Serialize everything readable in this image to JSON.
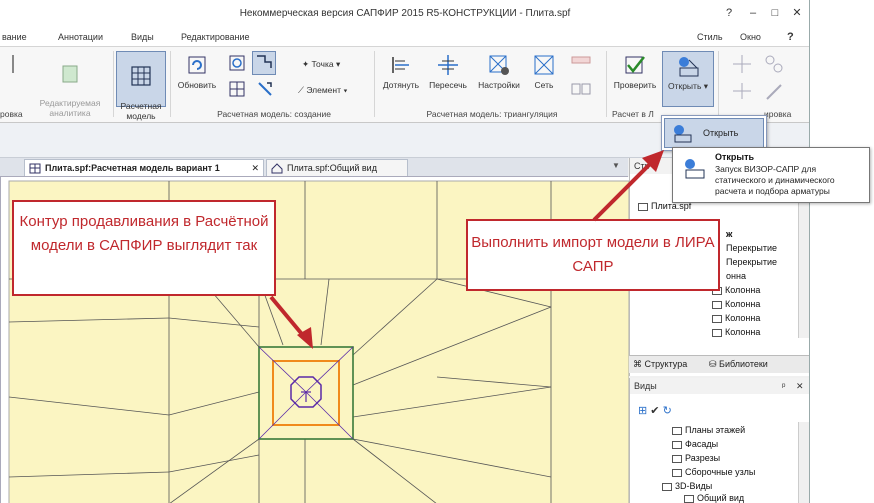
{
  "window": {
    "title": "Некоммерческая версия САПФИР 2015 R5-КОНСТРУКЦИИ - Плита.spf",
    "controls": [
      "?",
      "–",
      "□",
      "✕"
    ]
  },
  "menu": {
    "items": [
      "вание",
      "Аннотации",
      "Виды",
      "Редактирование"
    ],
    "style_label": "Стиль",
    "window_label": "Окно",
    "help": "?"
  },
  "ribbon": {
    "left_cut_label": "ровка",
    "analytics_label": "Редактируемая\nаналитика",
    "calc_model_label": "Расчетная\nмодель",
    "update_label": "Обновить",
    "point_label": "Точка",
    "element_label": "Элемент",
    "extend_label": "Дотянуть",
    "intersect_label": "Пересечь",
    "settings_label": "Настройки",
    "grid_label": "Сеть",
    "check_label": "Проверить",
    "open_label": "Открыть",
    "group_create": "Расчетная модель: создание",
    "group_triangulation": "Расчетная модель: триангуляция",
    "group_calc_cut": "Расчет в Л",
    "group_right_cut": "ировка"
  },
  "tabs": [
    {
      "label": "Плита.spf:Расчетная модель вариант 1",
      "close": "✕",
      "active": true
    },
    {
      "label": "Плита.spf:Общий вид",
      "close": "",
      "active": false
    }
  ],
  "dropdown": {
    "item_label": "Открыть"
  },
  "tooltip": {
    "title": "Открыть",
    "body": "Запуск ВИЗОР-САПР для статического и динамического расчета и подбора арматуры"
  },
  "structure_panel": {
    "header": "Стр",
    "items": [
      "Плита.spf",
      "...",
      "ж",
      "Перекрытие",
      "Перекрытие",
      "онна",
      "Колонна",
      "Колонна",
      "Колонна",
      "Колонна"
    ],
    "tab_structure": "Структура",
    "tab_libraries": "Библиотеки"
  },
  "views_panel": {
    "header": "Виды",
    "pin": "ᵖ",
    "close": "✕",
    "items": [
      "Планы этажей",
      "Фасады",
      "Разрезы",
      "Сборочные узлы",
      "3D-Виды",
      "Общий вид"
    ]
  },
  "annotations": {
    "left_callout": "Контур продавливания в Расчётной модели в САПФИР выглядит так",
    "right_callout": "Выполнить импорт модели в ЛИРА САПР"
  },
  "colors": {
    "callout_red": "#c0282d",
    "slab_fill": "#fbf5c2",
    "mesh_line": "#555555",
    "punch_green": "#3a7a3a",
    "punch_orange": "#f08a1c",
    "column_purple": "#5a2aa8"
  }
}
